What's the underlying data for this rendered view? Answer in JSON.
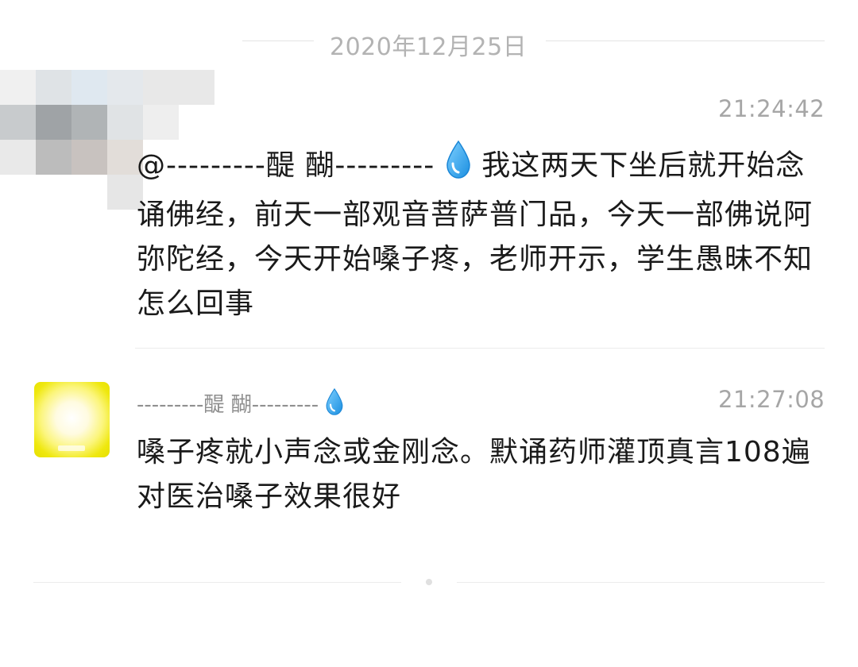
{
  "date_divider": {
    "text": "2020年12月25日"
  },
  "messages": [
    {
      "time": "21:24:42",
      "mention": "@---------醍 醐---------",
      "drop_icon": "water-drop-icon",
      "text_after": " 我这两天下坐后就开始念诵佛经，前天一部观音菩萨普门品，今天一部佛说阿弥陀经，今天开始嗓子疼，老师开示，学生愚昧不知怎么回事"
    },
    {
      "nickname": "---------醍 醐---------",
      "drop_icon": "water-drop-icon",
      "time": "21:27:08",
      "text": "嗓子疼就小声念或金刚念。默诵药师灌顶真言108遍对医治嗓子效果很好"
    }
  ],
  "colors": {
    "drop": "#2ea3f2",
    "avatar": "#efe80f",
    "text": "#1a1a1a",
    "muted": "#a6a6a6"
  }
}
